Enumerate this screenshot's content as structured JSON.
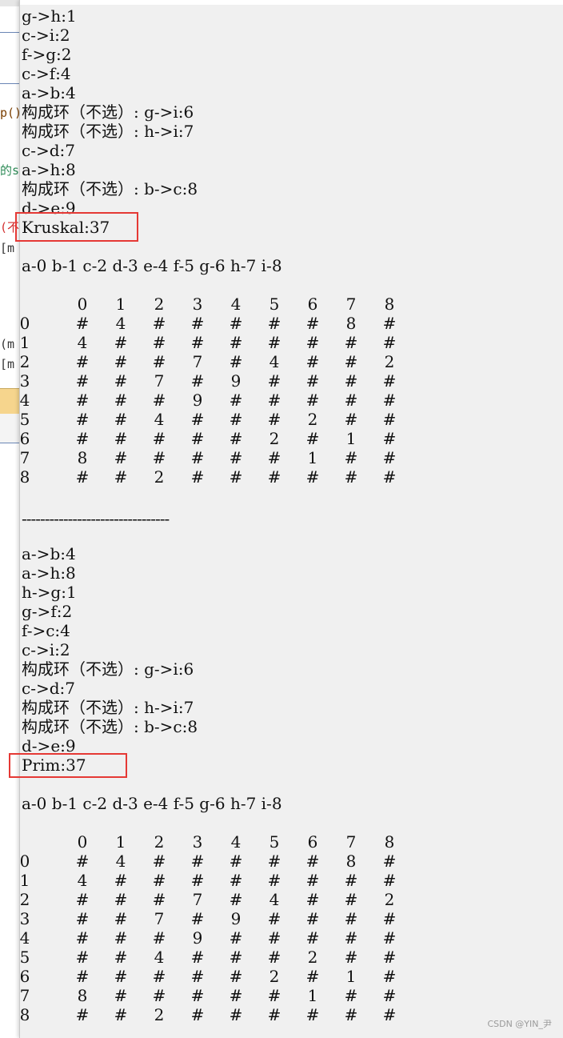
{
  "editor_fragments": [
    {
      "text": "p()",
      "color": "#7a3e00"
    },
    {
      "text": "的s",
      "color": "#2e8b57"
    },
    {
      "text": "(不",
      "color": "#d32f2f"
    },
    {
      "text": "[m",
      "color": "#333333"
    },
    {
      "text": "(m",
      "color": "#333333"
    },
    {
      "text": "[m",
      "color": "#333333"
    }
  ],
  "kruskal": {
    "edges": [
      "g->h:1",
      "c->i:2",
      "f->g:2",
      "c->f:4",
      "a->b:4",
      "构成环（不选）: g->i:6",
      "构成环（不选）: h->i:7",
      "c->d:7",
      "a->h:8",
      "构成环（不选）: b->c:8",
      "d->e:9"
    ],
    "total": "Kruskal:37",
    "mapping": "a-0 b-1 c-2 d-3 e-4 f-5 g-6 h-7 i-8"
  },
  "separator": "--------------------------------",
  "prim": {
    "edges": [
      "a->b:4",
      "a->h:8",
      "h->g:1",
      "g->f:2",
      "f->c:4",
      "c->i:2",
      "构成环（不选）: g->i:6",
      "c->d:7",
      "构成环（不选）: h->i:7",
      "构成环（不选）: b->c:8",
      "d->e:9"
    ],
    "total": "Prim:37",
    "mapping": "a-0 b-1 c-2 d-3 e-4 f-5 g-6 h-7 i-8"
  },
  "matrix": {
    "header": [
      "0",
      "1",
      "2",
      "3",
      "4",
      "5",
      "6",
      "7",
      "8"
    ],
    "rows": [
      {
        "label": "0",
        "cells": [
          "#",
          "4",
          "#",
          "#",
          "#",
          "#",
          "#",
          "8",
          "#"
        ]
      },
      {
        "label": "1",
        "cells": [
          "4",
          "#",
          "#",
          "#",
          "#",
          "#",
          "#",
          "#",
          "#"
        ]
      },
      {
        "label": "2",
        "cells": [
          "#",
          "#",
          "#",
          "7",
          "#",
          "4",
          "#",
          "#",
          "2"
        ]
      },
      {
        "label": "3",
        "cells": [
          "#",
          "#",
          "7",
          "#",
          "9",
          "#",
          "#",
          "#",
          "#"
        ]
      },
      {
        "label": "4",
        "cells": [
          "#",
          "#",
          "#",
          "9",
          "#",
          "#",
          "#",
          "#",
          "#"
        ]
      },
      {
        "label": "5",
        "cells": [
          "#",
          "#",
          "4",
          "#",
          "#",
          "#",
          "2",
          "#",
          "#"
        ]
      },
      {
        "label": "6",
        "cells": [
          "#",
          "#",
          "#",
          "#",
          "#",
          "2",
          "#",
          "1",
          "#"
        ]
      },
      {
        "label": "7",
        "cells": [
          "8",
          "#",
          "#",
          "#",
          "#",
          "#",
          "1",
          "#",
          "#"
        ]
      },
      {
        "label": "8",
        "cells": [
          "#",
          "#",
          "2",
          "#",
          "#",
          "#",
          "#",
          "#",
          "#"
        ]
      }
    ]
  },
  "highlight_color": "#e53935",
  "watermark": "CSDN @YIN_尹"
}
